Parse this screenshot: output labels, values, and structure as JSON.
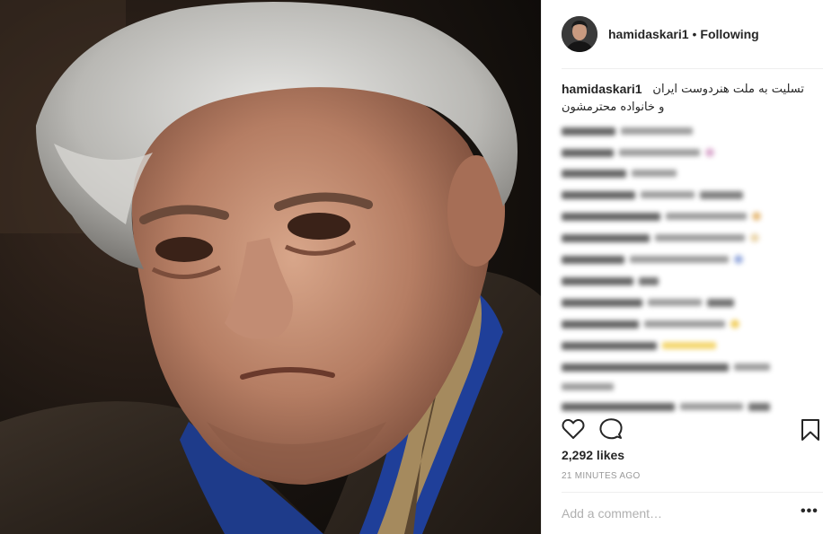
{
  "post": {
    "image_subject": "portrait photo of an elderly man with grey hair",
    "header": {
      "username": "hamidaskari1",
      "separator": "•",
      "follow_state": "Following"
    },
    "caption": {
      "username": "hamidaskari1",
      "line1": "تسلیت به ملت هنردوست ایران",
      "line2": "و خانواده محترمشون"
    },
    "likes": "2,292 likes",
    "timestamp": "21 MINUTES AGO",
    "add_comment_placeholder": "Add a comment…",
    "more_options": "•••"
  },
  "colors": {
    "text": "#262626",
    "muted": "#999999",
    "divider": "#efefef"
  },
  "icons": {
    "like": "heart-icon",
    "comment": "comment-bubble-icon",
    "save": "bookmark-icon",
    "more": "ellipsis-icon"
  }
}
